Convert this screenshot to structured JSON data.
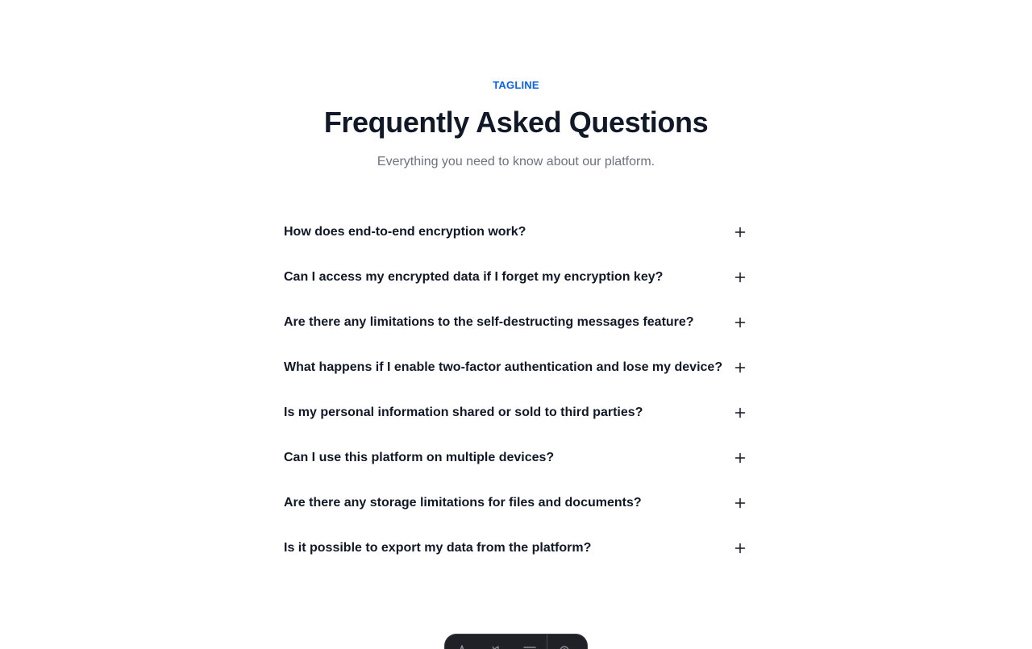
{
  "header": {
    "tagline": "TAGLINE",
    "title": "Frequently Asked Questions",
    "subtitle": "Everything you need to know about our platform."
  },
  "faq": {
    "items": [
      {
        "question": "How does end-to-end encryption work?",
        "icon": "plus-icon"
      },
      {
        "question": "Can I access my encrypted data if I forget my encryption key?",
        "icon": "plus-icon"
      },
      {
        "question": "Are there any limitations to the self-destructing messages feature?",
        "icon": "plus-icon"
      },
      {
        "question": "What happens if I enable two-factor authentication and lose my device?",
        "icon": "plus-icon"
      },
      {
        "question": "Is my personal information shared or sold to third parties?",
        "icon": "plus-icon"
      },
      {
        "question": "Can I use this platform on multiple devices?",
        "icon": "plus-icon"
      },
      {
        "question": "Are there any storage limitations for files and documents?",
        "icon": "plus-icon"
      },
      {
        "question": "Is it possible to export my data from the platform?",
        "icon": "plus-icon"
      }
    ]
  },
  "toolbar": {
    "icons": [
      "cursor-icon",
      "megaphone-icon",
      "menu-icon",
      "settings-icon"
    ]
  },
  "colors": {
    "accent": "#0b63e5",
    "heading": "#111827",
    "muted": "#6b7280",
    "toolbar_bg": "#1f2127"
  }
}
